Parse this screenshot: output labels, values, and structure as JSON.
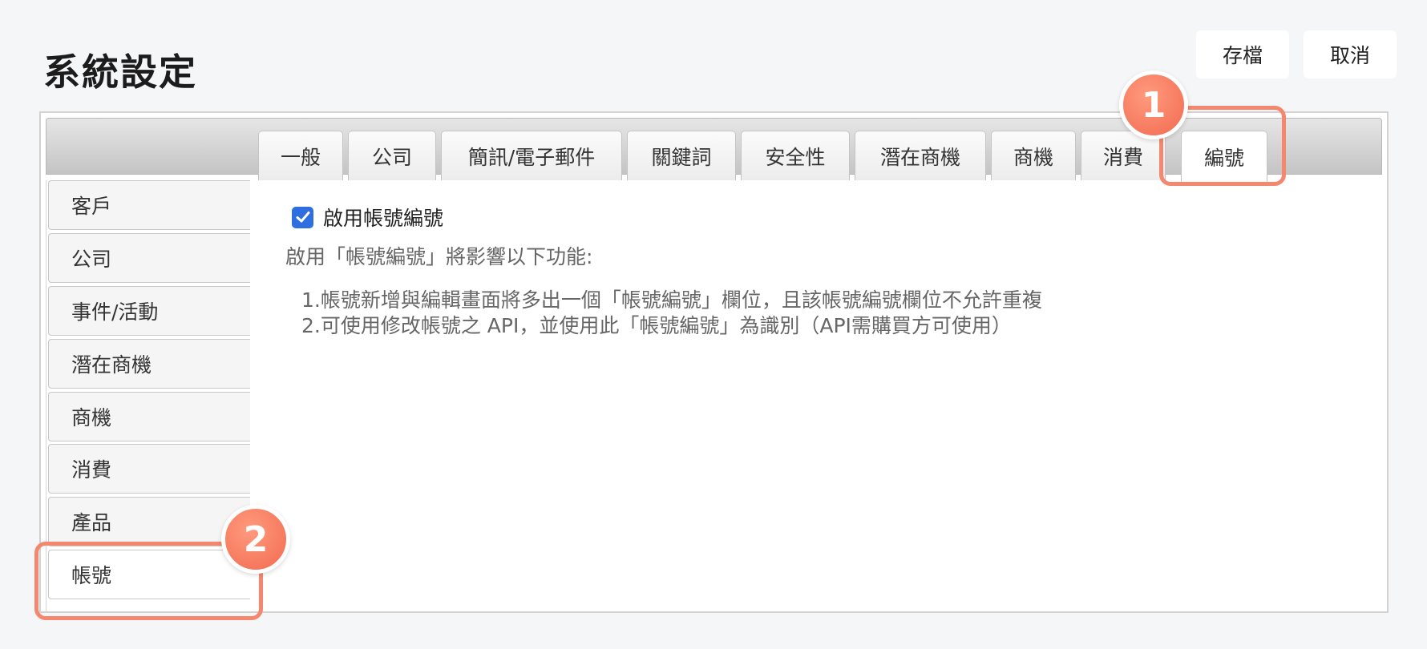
{
  "page": {
    "title": "系統設定"
  },
  "toolbar": {
    "save_label": "存檔",
    "cancel_label": "取消"
  },
  "tabs": [
    {
      "label": "一般"
    },
    {
      "label": "公司"
    },
    {
      "label": "簡訊/電子郵件"
    },
    {
      "label": "關鍵詞"
    },
    {
      "label": "安全性"
    },
    {
      "label": "潛在商機"
    },
    {
      "label": "商機"
    },
    {
      "label": "消費"
    },
    {
      "label": "編號"
    }
  ],
  "sidebar": {
    "items": [
      {
        "label": "客戶"
      },
      {
        "label": "公司"
      },
      {
        "label": "事件/活動"
      },
      {
        "label": "潛在商機"
      },
      {
        "label": "商機"
      },
      {
        "label": "消費"
      },
      {
        "label": "產品"
      },
      {
        "label": "帳號"
      }
    ]
  },
  "content": {
    "checkbox_label": "啟用帳號編號",
    "checkbox_checked": true,
    "description": "啟用「帳號編號」將影響以下功能:",
    "list": [
      "1.帳號新增與編輯畫面將多出一個「帳號編號」欄位，且該帳號編號欄位不允許重複",
      "2.可使用修改帳號之 API，並使用此「帳號編號」為識別（API需購買方可使用）"
    ]
  },
  "callouts": [
    {
      "number": "1"
    },
    {
      "number": "2"
    }
  ],
  "colors": {
    "callout": "#f5876e",
    "checkbox": "#2f6ee0"
  }
}
